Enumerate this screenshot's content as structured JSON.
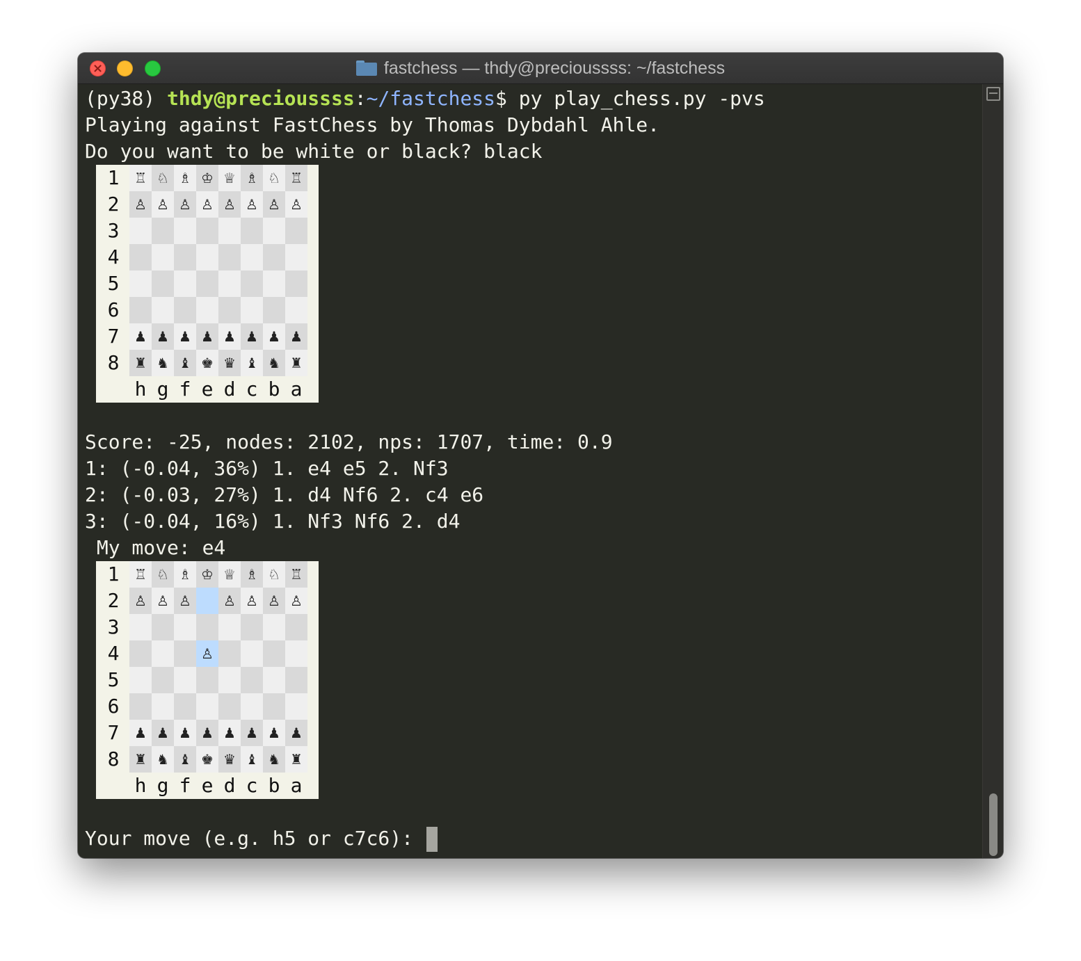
{
  "window": {
    "title": "fastchess — thdy@precioussss: ~/fastchess",
    "folder_icon": "folder-icon"
  },
  "colors": {
    "terminal_bg": "#282a24",
    "text": "#f2f2ea",
    "user_green": "#b6e354",
    "path_blue": "#8fb5ff",
    "highlight": "#bddcfe"
  },
  "terminal": {
    "prompt_env": "(py38) ",
    "prompt_user": "thdy@precioussss",
    "prompt_colon": ":",
    "prompt_path": "~/fastchess",
    "prompt_dollar": "$ ",
    "command": "py play_chess.py -pvs",
    "intro_line": "Playing against FastChess by Thomas Dybdahl Ahle.",
    "color_question": "Do you want to be white or black? black",
    "score_line": "Score: -25, nodes: 2102, nps: 1707, time: 0.9",
    "pv_lines": [
      "1: (-0.04, 36%) 1. e4 e5 2. Nf3",
      "2: (-0.03, 27%) 1. d4 Nf6 2. c4 e6",
      "3: (-0.04, 16%) 1. Nf3 Nf6 2. d4"
    ],
    "my_move_line": " My move: e4",
    "input_prompt": "Your move (e.g. h5 or c7c6): ",
    "input_value": ""
  },
  "boards": [
    {
      "ranks": [
        "1",
        "2",
        "3",
        "4",
        "5",
        "6",
        "7",
        "8"
      ],
      "files": [
        "h",
        "g",
        "f",
        "e",
        "d",
        "c",
        "b",
        "a"
      ],
      "rows": [
        [
          "♖",
          "♘",
          "♗",
          "♔",
          "♕",
          "♗",
          "♘",
          "♖"
        ],
        [
          "♙",
          "♙",
          "♙",
          "♙",
          "♙",
          "♙",
          "♙",
          "♙"
        ],
        [
          "",
          "",
          "",
          "",
          "",
          "",
          "",
          ""
        ],
        [
          "",
          "",
          "",
          "",
          "",
          "",
          "",
          ""
        ],
        [
          "",
          "",
          "",
          "",
          "",
          "",
          "",
          ""
        ],
        [
          "",
          "",
          "",
          "",
          "",
          "",
          "",
          ""
        ],
        [
          "♟",
          "♟",
          "♟",
          "♟",
          "♟",
          "♟",
          "♟",
          "♟"
        ],
        [
          "♜",
          "♞",
          "♝",
          "♚",
          "♛",
          "♝",
          "♞",
          "♜"
        ]
      ],
      "highlights": []
    },
    {
      "ranks": [
        "1",
        "2",
        "3",
        "4",
        "5",
        "6",
        "7",
        "8"
      ],
      "files": [
        "h",
        "g",
        "f",
        "e",
        "d",
        "c",
        "b",
        "a"
      ],
      "rows": [
        [
          "♖",
          "♘",
          "♗",
          "♔",
          "♕",
          "♗",
          "♘",
          "♖"
        ],
        [
          "♙",
          "♙",
          "♙",
          "",
          "♙",
          "♙",
          "♙",
          "♙"
        ],
        [
          "",
          "",
          "",
          "",
          "",
          "",
          "",
          ""
        ],
        [
          "",
          "",
          "",
          "♙",
          "",
          "",
          "",
          ""
        ],
        [
          "",
          "",
          "",
          "",
          "",
          "",
          "",
          ""
        ],
        [
          "",
          "",
          "",
          "",
          "",
          "",
          "",
          ""
        ],
        [
          "♟",
          "♟",
          "♟",
          "♟",
          "♟",
          "♟",
          "♟",
          "♟"
        ],
        [
          "♜",
          "♞",
          "♝",
          "♚",
          "♛",
          "♝",
          "♞",
          "♜"
        ]
      ],
      "highlights": [
        "e2",
        "e4"
      ]
    }
  ]
}
